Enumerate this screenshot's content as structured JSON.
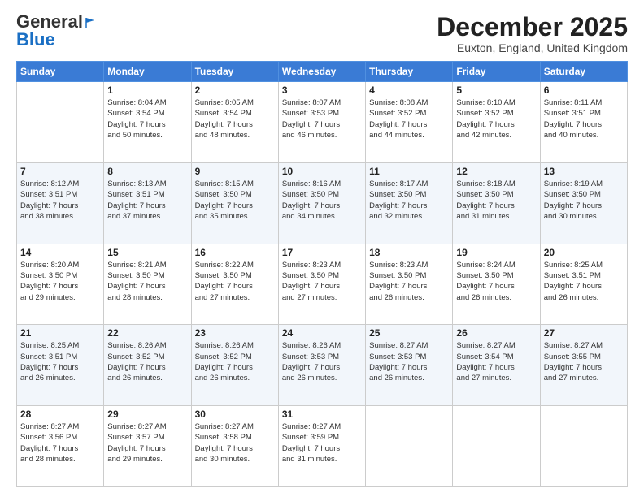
{
  "logo": {
    "general": "General",
    "blue": "Blue"
  },
  "header": {
    "month": "December 2025",
    "location": "Euxton, England, United Kingdom"
  },
  "days_of_week": [
    "Sunday",
    "Monday",
    "Tuesday",
    "Wednesday",
    "Thursday",
    "Friday",
    "Saturday"
  ],
  "weeks": [
    [
      {
        "day": "",
        "info": ""
      },
      {
        "day": "1",
        "info": "Sunrise: 8:04 AM\nSunset: 3:54 PM\nDaylight: 7 hours\nand 50 minutes."
      },
      {
        "day": "2",
        "info": "Sunrise: 8:05 AM\nSunset: 3:54 PM\nDaylight: 7 hours\nand 48 minutes."
      },
      {
        "day": "3",
        "info": "Sunrise: 8:07 AM\nSunset: 3:53 PM\nDaylight: 7 hours\nand 46 minutes."
      },
      {
        "day": "4",
        "info": "Sunrise: 8:08 AM\nSunset: 3:52 PM\nDaylight: 7 hours\nand 44 minutes."
      },
      {
        "day": "5",
        "info": "Sunrise: 8:10 AM\nSunset: 3:52 PM\nDaylight: 7 hours\nand 42 minutes."
      },
      {
        "day": "6",
        "info": "Sunrise: 8:11 AM\nSunset: 3:51 PM\nDaylight: 7 hours\nand 40 minutes."
      }
    ],
    [
      {
        "day": "7",
        "info": "Sunrise: 8:12 AM\nSunset: 3:51 PM\nDaylight: 7 hours\nand 38 minutes."
      },
      {
        "day": "8",
        "info": "Sunrise: 8:13 AM\nSunset: 3:51 PM\nDaylight: 7 hours\nand 37 minutes."
      },
      {
        "day": "9",
        "info": "Sunrise: 8:15 AM\nSunset: 3:50 PM\nDaylight: 7 hours\nand 35 minutes."
      },
      {
        "day": "10",
        "info": "Sunrise: 8:16 AM\nSunset: 3:50 PM\nDaylight: 7 hours\nand 34 minutes."
      },
      {
        "day": "11",
        "info": "Sunrise: 8:17 AM\nSunset: 3:50 PM\nDaylight: 7 hours\nand 32 minutes."
      },
      {
        "day": "12",
        "info": "Sunrise: 8:18 AM\nSunset: 3:50 PM\nDaylight: 7 hours\nand 31 minutes."
      },
      {
        "day": "13",
        "info": "Sunrise: 8:19 AM\nSunset: 3:50 PM\nDaylight: 7 hours\nand 30 minutes."
      }
    ],
    [
      {
        "day": "14",
        "info": "Sunrise: 8:20 AM\nSunset: 3:50 PM\nDaylight: 7 hours\nand 29 minutes."
      },
      {
        "day": "15",
        "info": "Sunrise: 8:21 AM\nSunset: 3:50 PM\nDaylight: 7 hours\nand 28 minutes."
      },
      {
        "day": "16",
        "info": "Sunrise: 8:22 AM\nSunset: 3:50 PM\nDaylight: 7 hours\nand 27 minutes."
      },
      {
        "day": "17",
        "info": "Sunrise: 8:23 AM\nSunset: 3:50 PM\nDaylight: 7 hours\nand 27 minutes."
      },
      {
        "day": "18",
        "info": "Sunrise: 8:23 AM\nSunset: 3:50 PM\nDaylight: 7 hours\nand 26 minutes."
      },
      {
        "day": "19",
        "info": "Sunrise: 8:24 AM\nSunset: 3:50 PM\nDaylight: 7 hours\nand 26 minutes."
      },
      {
        "day": "20",
        "info": "Sunrise: 8:25 AM\nSunset: 3:51 PM\nDaylight: 7 hours\nand 26 minutes."
      }
    ],
    [
      {
        "day": "21",
        "info": "Sunrise: 8:25 AM\nSunset: 3:51 PM\nDaylight: 7 hours\nand 26 minutes."
      },
      {
        "day": "22",
        "info": "Sunrise: 8:26 AM\nSunset: 3:52 PM\nDaylight: 7 hours\nand 26 minutes."
      },
      {
        "day": "23",
        "info": "Sunrise: 8:26 AM\nSunset: 3:52 PM\nDaylight: 7 hours\nand 26 minutes."
      },
      {
        "day": "24",
        "info": "Sunrise: 8:26 AM\nSunset: 3:53 PM\nDaylight: 7 hours\nand 26 minutes."
      },
      {
        "day": "25",
        "info": "Sunrise: 8:27 AM\nSunset: 3:53 PM\nDaylight: 7 hours\nand 26 minutes."
      },
      {
        "day": "26",
        "info": "Sunrise: 8:27 AM\nSunset: 3:54 PM\nDaylight: 7 hours\nand 27 minutes."
      },
      {
        "day": "27",
        "info": "Sunrise: 8:27 AM\nSunset: 3:55 PM\nDaylight: 7 hours\nand 27 minutes."
      }
    ],
    [
      {
        "day": "28",
        "info": "Sunrise: 8:27 AM\nSunset: 3:56 PM\nDaylight: 7 hours\nand 28 minutes."
      },
      {
        "day": "29",
        "info": "Sunrise: 8:27 AM\nSunset: 3:57 PM\nDaylight: 7 hours\nand 29 minutes."
      },
      {
        "day": "30",
        "info": "Sunrise: 8:27 AM\nSunset: 3:58 PM\nDaylight: 7 hours\nand 30 minutes."
      },
      {
        "day": "31",
        "info": "Sunrise: 8:27 AM\nSunset: 3:59 PM\nDaylight: 7 hours\nand 31 minutes."
      },
      {
        "day": "",
        "info": ""
      },
      {
        "day": "",
        "info": ""
      },
      {
        "day": "",
        "info": ""
      }
    ]
  ]
}
